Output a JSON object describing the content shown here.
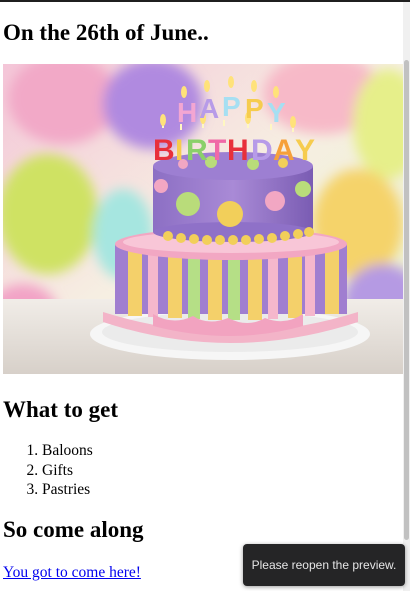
{
  "page": {
    "title": "On the 26th of June..",
    "hero_image": {
      "text": "HAPPY BIRTHDAY"
    },
    "section_get": {
      "heading": "What to get",
      "items": [
        "Baloons",
        "Gifts",
        "Pastries"
      ]
    },
    "section_come": {
      "heading": "So come along",
      "link_text": "You got to come here!"
    }
  },
  "toast": {
    "message": "Please reopen the preview."
  },
  "colors": {
    "link": "#0000ee",
    "toast_bg": "#252526"
  }
}
